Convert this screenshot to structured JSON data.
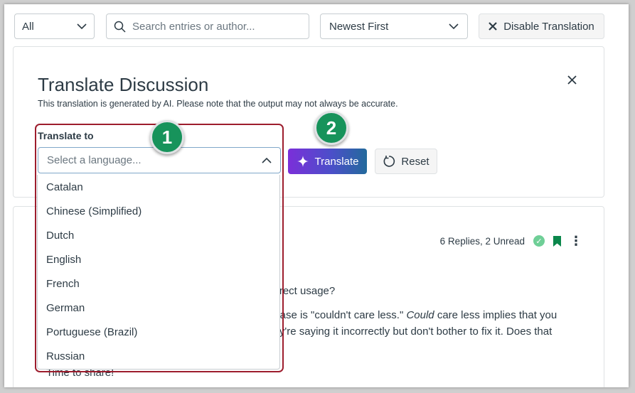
{
  "toolbar": {
    "filter_value": "All",
    "search_placeholder": "Search entries or author...",
    "sort_value": "Newest First",
    "disable_label": "Disable Translation"
  },
  "translate_panel": {
    "title": "Translate Discussion",
    "note": "This translation is generated by AI. Please note that the output may not always be accurate.",
    "field_label": "Translate to",
    "select_placeholder": "Select a language...",
    "translate_label": "Translate",
    "reset_label": "Reset"
  },
  "languages": [
    "Catalan",
    "Chinese (Simplified)",
    "Dutch",
    "English",
    "French",
    "German",
    "Portuguese (Brazil)",
    "Russian"
  ],
  "post": {
    "meta": "6 Replies, 2 Unread",
    "line1": "correct usage?",
    "line2a": "phrase is \"couldn't care less.\" ",
    "line2b": "Could",
    "line2c": " care less implies that you",
    "line3": "they're saying it incorrectly but don't bother to fix it. Does that",
    "line4": "Time to share!"
  },
  "callouts": [
    "1",
    "2"
  ],
  "colors": {
    "highlight": "#9d1d2d",
    "callout": "#17935b",
    "translate_gradient": [
      "#7b2fd9",
      "#236a9c"
    ],
    "read_check": "#6fcf97",
    "bookmark": "#0b874b"
  }
}
